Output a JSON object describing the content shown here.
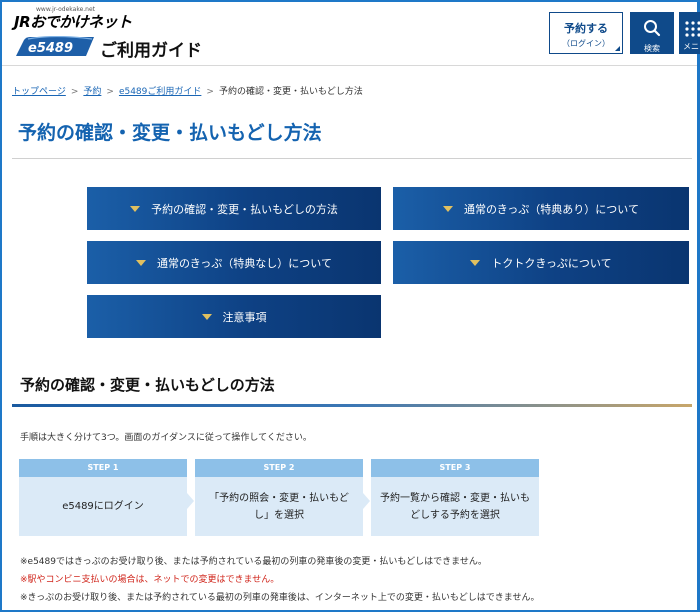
{
  "header": {
    "site_url": "www.jr-odekake.net",
    "site_logo": "JRおでかけネット",
    "brand": "e5489",
    "title": "ご利用ガイド",
    "reserve_button": {
      "line1": "予約する",
      "line2": "（ログイン）"
    },
    "search_button": {
      "label": "検索",
      "icon": "search-icon"
    },
    "menu_button": {
      "label": "メニュー",
      "icon": "menu-icon"
    }
  },
  "breadcrumb": [
    {
      "label": "トップページ",
      "link": true
    },
    {
      "label": "予約",
      "link": true
    },
    {
      "label": "e5489ご利用ガイド",
      "link": true
    },
    {
      "label": "予約の確認・変更・払いもどし方法",
      "link": false
    }
  ],
  "page_title": "予約の確認・変更・払いもどし方法",
  "nav_buttons": [
    "予約の確認・変更・払いもどしの方法",
    "通常のきっぷ（特典あり）について",
    "通常のきっぷ（特典なし）について",
    "トクトクきっぷについて",
    "注意事項"
  ],
  "section": {
    "title": "予約の確認・変更・払いもどしの方法",
    "intro": "手順は大きく分けて3つ。画面のガイダンスに従って操作してください。",
    "steps": [
      {
        "label": "STEP 1",
        "lines": [
          "e5489にログイン"
        ]
      },
      {
        "label": "STEP 2",
        "lines": [
          "「予約の照会・変更・払いもど",
          "し」を選択"
        ]
      },
      {
        "label": "STEP 3",
        "lines": [
          "予約一覧から確認・変更・払いも",
          "どしする予約を選択"
        ]
      }
    ],
    "notes": [
      {
        "text": "※e5489ではきっぷのお受け取り後、または予約されている最初の列車の発車後の変更・払いもどしはできません。",
        "color": "#333333"
      },
      {
        "text": "※駅やコンビニ支払いの場合は、ネットでの変更はできません。",
        "color": "#d0261c"
      },
      {
        "text": "※きっぷのお受け取り後、または予約されている最初の列車の発車後は、インターネット上での変更・払いもどしはできません。",
        "color": "#333333"
      }
    ]
  },
  "colors": {
    "primary": "#0f4a8a",
    "title_blue": "#1463b0",
    "step_header": "#8dc0e8",
    "step_body": "#dbeaf7",
    "note_red": "#d0261c",
    "accent_gold": "#e0c060"
  }
}
